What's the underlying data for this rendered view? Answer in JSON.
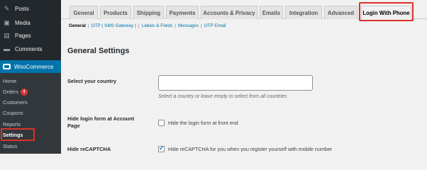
{
  "sidebar": {
    "items": [
      {
        "label": "Posts",
        "icon": "pin-icon"
      },
      {
        "label": "Media",
        "icon": "media-icon"
      },
      {
        "label": "Pages",
        "icon": "pages-icon"
      },
      {
        "label": "Comments",
        "icon": "comments-icon"
      }
    ],
    "woocommerce_label": "WooCommerce",
    "submenu": [
      {
        "label": "Home"
      },
      {
        "label": "Orders",
        "badge": "4"
      },
      {
        "label": "Customers"
      },
      {
        "label": "Coupons"
      },
      {
        "label": "Reports"
      },
      {
        "label": "Settings"
      },
      {
        "label": "Status"
      }
    ]
  },
  "tabs": [
    {
      "label": "General"
    },
    {
      "label": "Products"
    },
    {
      "label": "Shipping"
    },
    {
      "label": "Payments"
    },
    {
      "label": "Accounts & Privacy"
    },
    {
      "label": "Emails"
    },
    {
      "label": "Integration"
    },
    {
      "label": "Advanced"
    },
    {
      "label": "Login With Phone"
    }
  ],
  "subnav": {
    "items": [
      "General",
      "OTP ( SMS Gateway )",
      "Labels & Fields",
      "Messages",
      "OTP Email"
    ],
    "separator": "|"
  },
  "page": {
    "heading": "General Settings",
    "country_label": "Select your country",
    "country_help_icon": "?",
    "country_value": "",
    "country_desc": "Select a country or leave empty to select from all countries",
    "hide_login_label": "Hide login form at Account Page",
    "hide_login_checkbox_label": "Hide the login form at front end",
    "hide_login_checked": false,
    "recaptcha_label": "Hide reCAPTCHA",
    "recaptcha_checkbox_label": "Hide reCAPTCHA for you when you register yourself with mobile number",
    "recaptcha_checked": true
  },
  "colors": {
    "sidebar_bg": "#23282d",
    "accent": "#0073aa",
    "highlight": "#d9332a",
    "badge": "#d63638"
  }
}
